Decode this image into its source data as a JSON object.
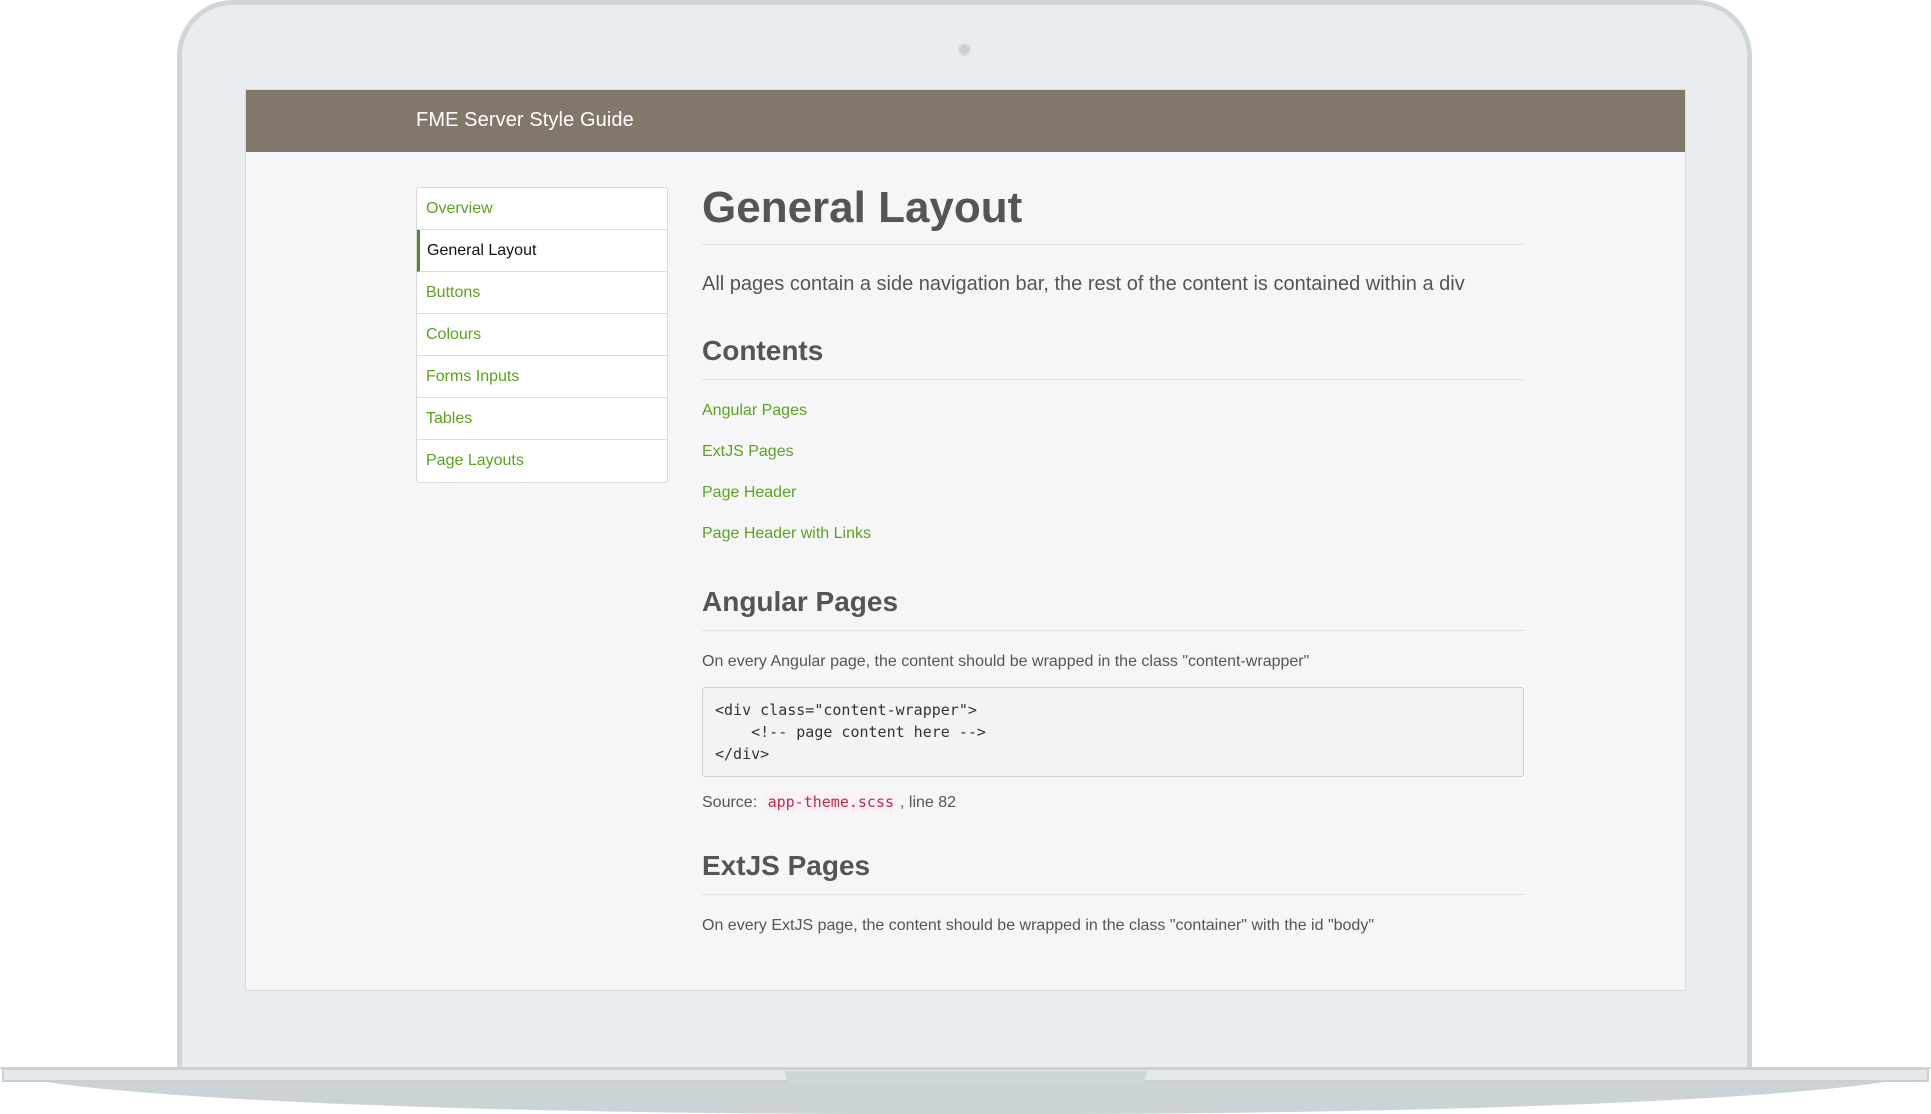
{
  "app": {
    "title": "FME Server Style Guide"
  },
  "sidebar": {
    "items": [
      {
        "label": "Overview"
      },
      {
        "label": "General Layout",
        "active": true
      },
      {
        "label": "Buttons"
      },
      {
        "label": "Colours"
      },
      {
        "label": "Forms Inputs"
      },
      {
        "label": "Tables"
      },
      {
        "label": "Page Layouts"
      }
    ]
  },
  "main": {
    "title": "General Layout",
    "lead": "All pages contain a side navigation bar, the rest of the content is contained within a div",
    "contents": {
      "title": "Contents",
      "links": [
        "Angular Pages",
        "ExtJS Pages",
        "Page Header",
        "Page Header with Links"
      ]
    },
    "angular": {
      "title": "Angular Pages",
      "description": "On every Angular page, the content should be wrapped in the class \"content-wrapper\"",
      "code": "<div class=\"content-wrapper\">\n    <!-- page content here -->\n</div>",
      "source_prefix": "Source:",
      "source_file": "app-theme.scss",
      "source_suffix": ", line 82"
    },
    "extjs": {
      "title": "ExtJS Pages",
      "description": "On every ExtJS page, the content should be wrapped in the class \"container\" with the id \"body\""
    }
  },
  "colors": {
    "header_bg": "#82776b",
    "link_green": "#58a51c",
    "active_border": "#4d8b2e",
    "code_red": "#c7254e"
  }
}
